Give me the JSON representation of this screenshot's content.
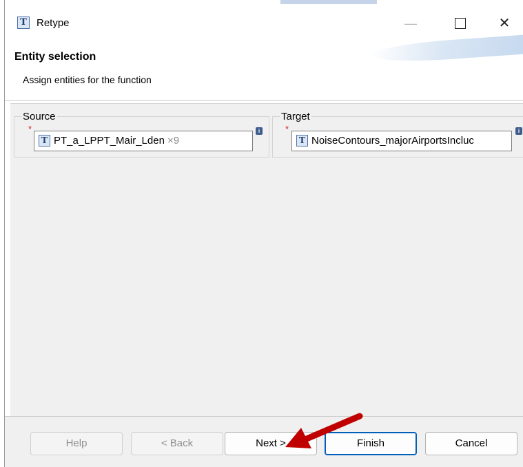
{
  "window": {
    "title": "Retype",
    "icon_glyph": "T",
    "controls": {
      "minimize": "—",
      "maximize": "",
      "close": "✕"
    }
  },
  "banner": {
    "title": "Entity selection",
    "description": "Assign entities for the function"
  },
  "source": {
    "legend": "Source",
    "required_mark": "*",
    "type_glyph": "T",
    "value": "PT_a_LPPT_Mair_Lden",
    "count": "×9",
    "info_glyph": "i"
  },
  "target": {
    "legend": "Target",
    "required_mark": "*",
    "type_glyph": "T",
    "value": "NoiseContours_majorAirportsIncluc",
    "info_glyph": "i"
  },
  "buttons": {
    "help": "Help",
    "back": "< Back",
    "next": "Next >",
    "finish": "Finish",
    "cancel": "Cancel"
  },
  "colors": {
    "accent": "#005fb8",
    "required": "#d02020",
    "annotation_arrow": "#c00000"
  }
}
